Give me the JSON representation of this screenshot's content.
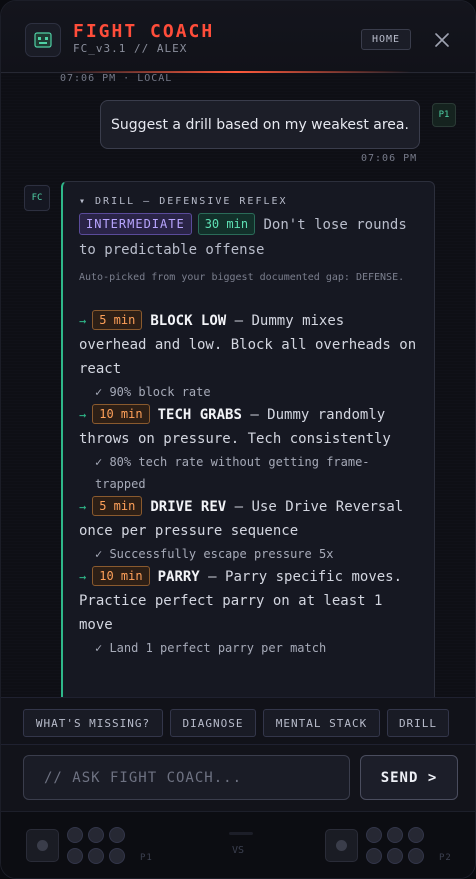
{
  "header": {
    "title": "FIGHT COACH",
    "subtitle": "FC_v3.1 // ALEX",
    "home_label": "HOME",
    "close_icon": "close-icon",
    "logo_icon": "robot-face-icon",
    "accent_color": "#ff4d3a"
  },
  "chat": {
    "top_timestamp": "07:06 PM · LOCAL",
    "user_message": {
      "avatar": "P1",
      "text": "Suggest a drill based on my weakest area.",
      "timestamp": "07:06 PM"
    },
    "bot_message": {
      "avatar": "FC",
      "title": "▾ DRILL — DEFENSIVE REFLEX",
      "level": "INTERMEDIATE",
      "duration": "30 min",
      "objective": "Don't lose rounds to predictable offense",
      "note": "Auto-picked from your biggest documented gap: DEFENSE.",
      "drills": [
        {
          "time": "5 min",
          "name": "BLOCK LOW",
          "desc": " — Dummy mixes overhead and low. Block all overheads on react",
          "goal": "✓ 90% block rate"
        },
        {
          "time": "10 min",
          "name": "TECH GRABS",
          "desc": " — Dummy randomly throws on pressure. Tech consistently",
          "goal": "✓ 80% tech rate without getting frame-trapped"
        },
        {
          "time": "5 min",
          "name": "DRIVE REV",
          "desc": " — Use Drive Reversal once per pressure sequence",
          "goal": "✓ Successfully escape pressure 5x"
        },
        {
          "time": "10 min",
          "name": "PARRY",
          "desc": " — Parry specific moves. Practice perfect parry on at least 1 move",
          "goal": "✓ Land 1 perfect parry per match"
        }
      ]
    }
  },
  "quick_actions": [
    "WHAT'S MISSING?",
    "DIAGNOSE",
    "MENTAL STACK",
    "DRILL"
  ],
  "input": {
    "placeholder": "// ASK FIGHT COACH...",
    "value": "",
    "send_label": "SEND >"
  },
  "panel": {
    "p1": "P1",
    "vs": "VS",
    "p2": "P2"
  }
}
